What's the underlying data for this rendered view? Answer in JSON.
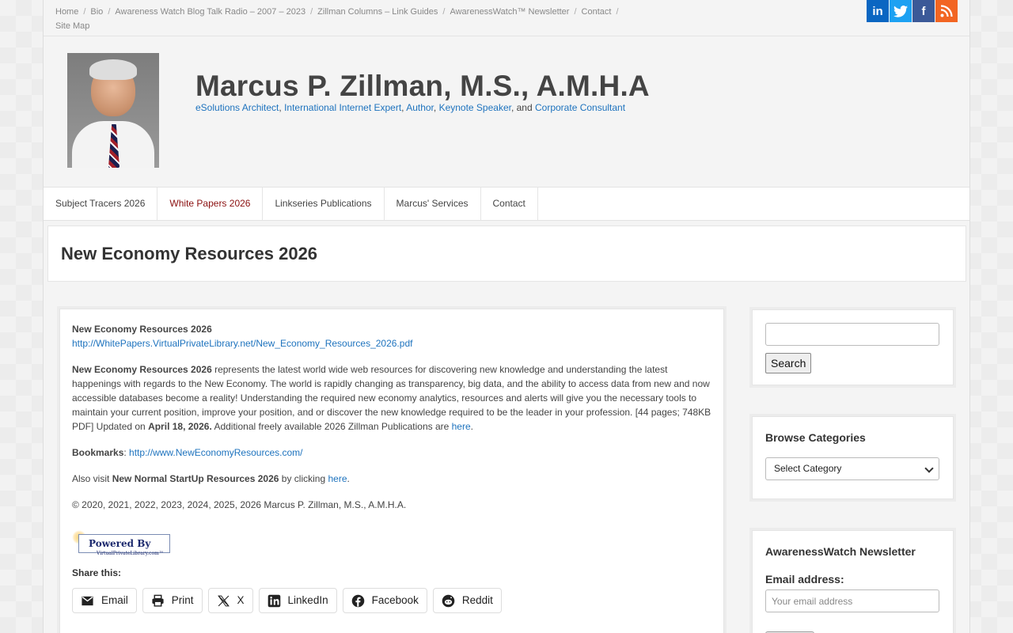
{
  "topnav": {
    "items": [
      "Home",
      "Bio",
      "Awareness Watch Blog Talk Radio – 2007 – 2023",
      "Zillman Columns – Link Guides",
      "AwarenessWatch™ Newsletter",
      "Contact",
      "Site Map"
    ]
  },
  "social": {
    "linkedin": "in",
    "twitter": "t",
    "facebook": "f",
    "rss": "rss"
  },
  "header": {
    "site_title": "Marcus P. Zillman, M.S., A.M.H.A",
    "tagline": {
      "t1": "eSolutions Architect",
      "s1": ", ",
      "t2": "International Internet Expert",
      "s2": ", ",
      "t3": "Author",
      "s3": ", ",
      "t4": "Keynote Speaker",
      "s4": ", and ",
      "t5": "Corporate Consultant"
    }
  },
  "mainnav": {
    "items": [
      "Subject Tracers 2026",
      "White Papers 2026",
      "Linkseries Publications",
      "Marcus' Services",
      "Contact"
    ],
    "active": "White Papers 2026"
  },
  "page": {
    "title": "New Economy Resources 2026"
  },
  "content": {
    "p1_title": "New Economy Resources 2026",
    "p1_url": "http://WhitePapers.VirtualPrivateLibrary.net/New_Economy_Resources_2026.pdf",
    "p2_bold": "New Economy Resources 2026",
    "p2_text": " represents the latest world wide web resources for discovering new knowledge and understanding the latest happenings with regards to the New Economy. The world is rapidly changing as transparency, big data, and the ability to access data from new and now accessible databases become a reality! Understanding the required new economy analytics, resources and alerts will give you the necessary tools to maintain your current position, improve your position, and or discover the new knowledge required to be the leader in your profession. [44 pages; 748KB PDF] Updated on ",
    "p2_date": "April 18, 2026.",
    "p2_tail": " Additional freely available 2026 Zillman Publications are ",
    "p2_link": "here",
    "p2_end": ".",
    "bm_label": "Bookmarks",
    "bm_sep": ": ",
    "bm_url": "http://www.NewEconomyResources.com/",
    "also_pre": "Also visit ",
    "also_bold": "New Normal StartUp Resources 2026",
    "also_mid": " by clicking ",
    "also_link": "here",
    "also_end": ".",
    "copyright": "© 2020, 2021, 2022, 2023, 2024, 2025, 2026 Marcus P. Zillman, M.S., A.M.H.A.",
    "powered_by": "Powered By",
    "powered_site": "VirtualPrivateLibrary.com™",
    "share_title": "Share this:",
    "share": [
      "Email",
      "Print",
      "X",
      "LinkedIn",
      "Facebook",
      "Reddit"
    ]
  },
  "sidebar": {
    "search_button": "Search",
    "categories_title": "Browse Categories",
    "categories_selected": "Select Category",
    "newsletter_title": "AwarenessWatch Newsletter",
    "email_label": "Email address:",
    "email_placeholder": "Your email address"
  },
  "colors": {
    "link": "#1e73be",
    "active_nav": "#8b1010",
    "linkedin": "#0a66c2",
    "twitter": "#1da1f2",
    "facebook": "#3b5998",
    "rss": "#f26522"
  }
}
